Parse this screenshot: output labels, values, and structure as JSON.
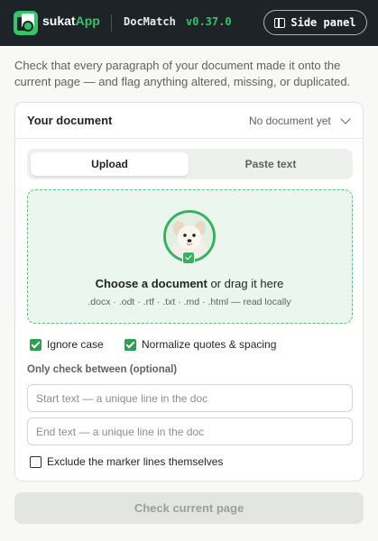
{
  "header": {
    "brand_part1": "sukat",
    "brand_part2": "App",
    "app_name": "DocMatch",
    "version": "v0.37.0",
    "side_panel_label": "Side panel",
    "brand_color": "#35c46a"
  },
  "intro": "Check that every paragraph of your document made it onto the current page — and flag anything altered, missing, or duplicated.",
  "document": {
    "title": "Your document",
    "status": "No document yet",
    "tabs": [
      "Upload",
      "Paste text"
    ],
    "active_tab": "Upload",
    "dropzone": {
      "choose": "Choose a document",
      "rest": " or drag it here",
      "formats": ".docx · .odt · .rtf · .txt · .md · .html — read locally"
    },
    "options": {
      "ignore_case": {
        "label": "Ignore case",
        "checked": true
      },
      "normalize": {
        "label": "Normalize quotes & spacing",
        "checked": true
      }
    },
    "range": {
      "label": "Only check between (optional)",
      "start_placeholder": "Start text — a unique line in the doc",
      "end_placeholder": "End text — a unique line in the doc",
      "exclude_label": "Exclude the marker lines themselves",
      "exclude_checked": false
    }
  },
  "action": {
    "check_label": "Check current page",
    "enabled": false
  }
}
